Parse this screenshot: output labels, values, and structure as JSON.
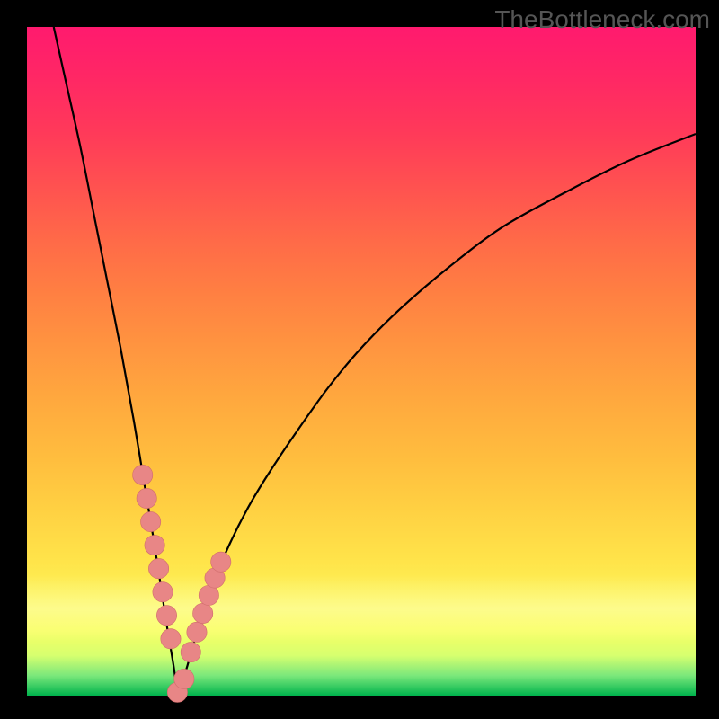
{
  "watermark": "TheBottleneck.com",
  "colors": {
    "frame": "#000000",
    "curve_stroke": "#000000",
    "marker_fill": "#e88686",
    "marker_stroke": "#d06c6c",
    "gradient_top": "#ff1a6e",
    "gradient_bottom": "#00b34d"
  },
  "chart_data": {
    "type": "line",
    "title": "",
    "xlabel": "",
    "ylabel": "",
    "xlim": [
      0,
      100
    ],
    "ylim": [
      0,
      100
    ],
    "note": "Axes are unlabeled in the image; x and y are estimated percentages of the plot area (0 = left/bottom edge, 100 = right/top). The curve is a V-shaped well with minimum near x≈22.5, y≈0. Pink markers cluster along the two walls of the well near the bottom.",
    "series": [
      {
        "name": "curve",
        "x": [
          4,
          6,
          8,
          10,
          12,
          14,
          16,
          18,
          19,
          20,
          21,
          22,
          22.5,
          23,
          24,
          25,
          26,
          28,
          30,
          33,
          36,
          40,
          45,
          50,
          56,
          63,
          71,
          80,
          90,
          100
        ],
        "y": [
          100,
          91,
          82,
          72,
          62,
          52,
          41,
          29,
          23,
          16.5,
          10,
          4,
          0,
          1.2,
          4.5,
          8,
          11,
          17,
          22,
          28,
          33,
          39,
          46,
          52,
          58,
          64,
          70,
          75,
          80,
          84
        ]
      }
    ],
    "markers": {
      "x": [
        17.3,
        17.9,
        18.5,
        19.1,
        19.7,
        20.3,
        20.9,
        21.5,
        22.5,
        23.5,
        24.5,
        25.4,
        26.3,
        27.2,
        28.1,
        29.0
      ],
      "y": [
        33.0,
        29.5,
        26.0,
        22.5,
        19.0,
        15.5,
        12.0,
        8.5,
        0.5,
        2.5,
        6.5,
        9.5,
        12.3,
        15.0,
        17.6,
        20.0
      ],
      "r": 1.5
    }
  }
}
